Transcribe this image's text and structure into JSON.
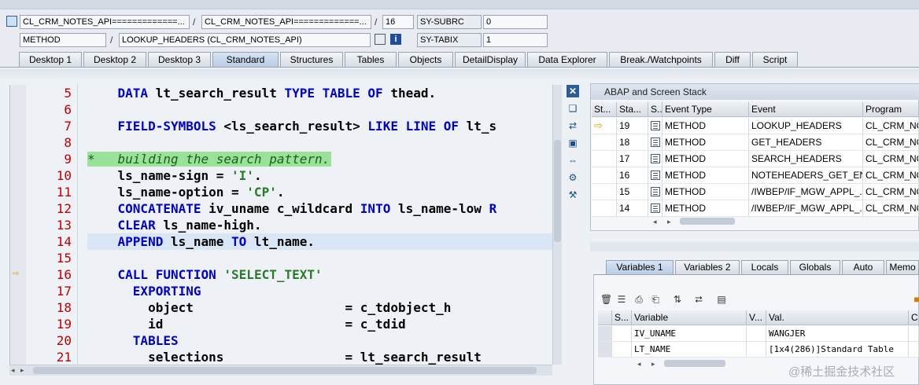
{
  "header": {
    "row1": {
      "program_field": "CL_CRM_NOTES_API=============...",
      "include_field": "CL_CRM_NOTES_API=============...",
      "line_field": "16",
      "sysvar_label": "SY-SUBRC",
      "sysvar_value": "0",
      "sep1": "/",
      "sep2": "/"
    },
    "row2": {
      "type_field": "METHOD",
      "name_field": "LOOKUP_HEADERS (CL_CRM_NOTES_API)",
      "sysvar_label": "SY-TABIX",
      "sysvar_value": "1",
      "sep1": "/"
    }
  },
  "tabs": [
    "Desktop 1",
    "Desktop 2",
    "Desktop 3",
    "Standard",
    "Structures",
    "Tables",
    "Objects",
    "DetailDisplay",
    "Data Explorer",
    "Break./Watchpoints",
    "Diff",
    "Script"
  ],
  "code": {
    "lines": [
      {
        "n": "5",
        "segs": [
          {
            "t": "    ",
            "c": "plain"
          },
          {
            "t": "DATA",
            "c": "kw"
          },
          {
            "t": " lt_search_result ",
            "c": "plain"
          },
          {
            "t": "TYPE TABLE OF",
            "c": "kw"
          },
          {
            "t": " thead.",
            "c": "plain"
          }
        ]
      },
      {
        "n": "6",
        "segs": []
      },
      {
        "n": "7",
        "segs": [
          {
            "t": "    ",
            "c": "plain"
          },
          {
            "t": "FIELD-SYMBOLS",
            "c": "kw"
          },
          {
            "t": " <ls_search_result> ",
            "c": "plain"
          },
          {
            "t": "LIKE LINE OF",
            "c": "kw"
          },
          {
            "t": " lt_s",
            "c": "plain"
          }
        ]
      },
      {
        "n": "8",
        "segs": []
      },
      {
        "n": "9",
        "segs": [
          {
            "t": "*   building the search pattern.",
            "c": "cmt"
          }
        ]
      },
      {
        "n": "10",
        "segs": [
          {
            "t": "    ls_name-sign = ",
            "c": "plain"
          },
          {
            "t": "'I'",
            "c": "str"
          },
          {
            "t": ".",
            "c": "plain"
          }
        ]
      },
      {
        "n": "11",
        "segs": [
          {
            "t": "    ls_name-option = ",
            "c": "plain"
          },
          {
            "t": "'CP'",
            "c": "str"
          },
          {
            "t": ".",
            "c": "plain"
          }
        ]
      },
      {
        "n": "12",
        "segs": [
          {
            "t": "    ",
            "c": "plain"
          },
          {
            "t": "CONCATENATE",
            "c": "kw"
          },
          {
            "t": " iv_uname c_wildcard ",
            "c": "plain"
          },
          {
            "t": "INTO",
            "c": "kw"
          },
          {
            "t": " ls_name-low ",
            "c": "plain"
          },
          {
            "t": "R",
            "c": "kw"
          }
        ]
      },
      {
        "n": "13",
        "segs": [
          {
            "t": "    ",
            "c": "plain"
          },
          {
            "t": "CLEAR",
            "c": "kw"
          },
          {
            "t": " ls_name-high.",
            "c": "plain"
          }
        ]
      },
      {
        "n": "14",
        "segs": [
          {
            "t": "    ",
            "c": "plain"
          },
          {
            "t": "APPEND",
            "c": "kw"
          },
          {
            "t": " ls_name ",
            "c": "plain"
          },
          {
            "t": "TO",
            "c": "kw"
          },
          {
            "t": " lt_name.",
            "c": "plain"
          }
        ]
      },
      {
        "n": "15",
        "segs": []
      },
      {
        "n": "16",
        "segs": [
          {
            "t": "    ",
            "c": "plain"
          },
          {
            "t": "CALL FUNCTION",
            "c": "kw"
          },
          {
            "t": " ",
            "c": "plain"
          },
          {
            "t": "'SELECT_TEXT'",
            "c": "str"
          }
        ]
      },
      {
        "n": "17",
        "segs": [
          {
            "t": "      ",
            "c": "plain"
          },
          {
            "t": "EXPORTING",
            "c": "kw"
          }
        ]
      },
      {
        "n": "18",
        "segs": [
          {
            "t": "        object                    = c_tdobject_h",
            "c": "plain"
          }
        ]
      },
      {
        "n": "19",
        "segs": [
          {
            "t": "        id                        = c_tdid",
            "c": "plain"
          }
        ]
      },
      {
        "n": "20",
        "segs": [
          {
            "t": "      ",
            "c": "plain"
          },
          {
            "t": "TABLES",
            "c": "kw"
          }
        ]
      },
      {
        "n": "21",
        "segs": [
          {
            "t": "        selections                = lt_search_result",
            "c": "plain"
          }
        ]
      }
    ]
  },
  "stack": {
    "title": "ABAP and Screen Stack",
    "columns": [
      "St...",
      "Sta...",
      "S...",
      "Event Type",
      "Event",
      "Program"
    ],
    "rows": [
      {
        "level": "19",
        "type": "METHOD",
        "event": "LOOKUP_HEADERS",
        "program": "CL_CRM_NO",
        "current": true
      },
      {
        "level": "18",
        "type": "METHOD",
        "event": "GET_HEADERS",
        "program": "CL_CRM_NO",
        "current": false
      },
      {
        "level": "17",
        "type": "METHOD",
        "event": "SEARCH_HEADERS",
        "program": "CL_CRM_NO",
        "current": false
      },
      {
        "level": "16",
        "type": "METHOD",
        "event": "NOTEHEADERS_GET_EN...",
        "program": "CL_CRM_NO",
        "current": false
      },
      {
        "level": "15",
        "type": "METHOD",
        "event": "/IWBEP/IF_MGW_APPL_...",
        "program": "CL_CRM_NO",
        "current": false
      },
      {
        "level": "14",
        "type": "METHOD",
        "event": "/IWBEP/IF_MGW_APPL_...",
        "program": "CL_CRM_NO",
        "current": false
      }
    ]
  },
  "var_tabs": [
    "Variables 1",
    "Variables 2",
    "Locals",
    "Globals",
    "Auto",
    "Memo"
  ],
  "variables": {
    "columns": [
      "S...",
      "Variable",
      "V...",
      "Val.",
      "C."
    ],
    "rows": [
      {
        "name": "IV_UNAME",
        "value": "WANGJER"
      },
      {
        "name": "LT_NAME",
        "value": "[1x4(286)]Standard Table"
      }
    ]
  },
  "watermark": "@稀土掘金技术社区",
  "colors": {
    "keyword": "#0000d0",
    "line_number": "#c00000",
    "comment_bg": "#9ae29a",
    "active_tab": "#b9cde4"
  }
}
